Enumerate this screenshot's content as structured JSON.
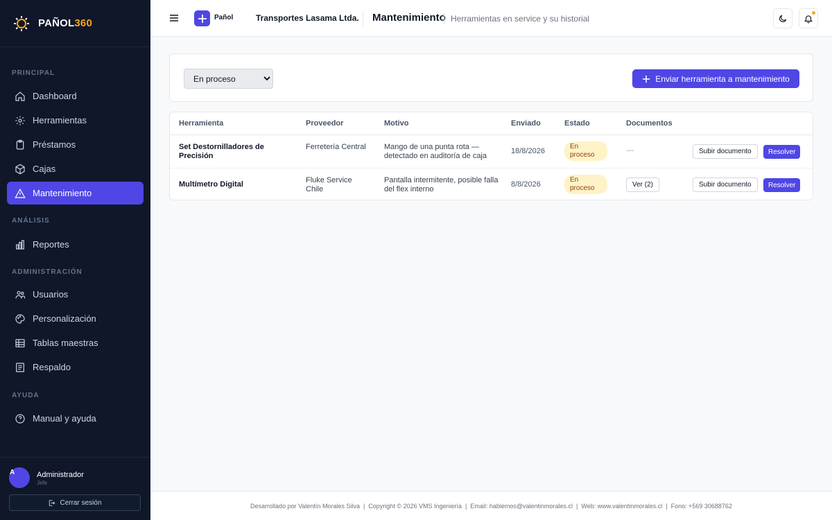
{
  "brand": {
    "name_main": "PAÑOL",
    "name_accent": "360",
    "accent_color": "#f5a623"
  },
  "sidebar": {
    "sections": [
      {
        "label": "PRINCIPAL"
      },
      {
        "label": "ANÁLISIS"
      },
      {
        "label": "ADMINISTRACIÓN"
      },
      {
        "label": "AYUDA"
      }
    ],
    "items": [
      {
        "label": "Dashboard",
        "icon": "home-icon"
      },
      {
        "label": "Herramientas",
        "icon": "gear-icon"
      },
      {
        "label": "Préstamos",
        "icon": "clipboard-icon"
      },
      {
        "label": "Cajas",
        "icon": "box-icon"
      },
      {
        "label": "Mantenimiento",
        "icon": "warning-icon",
        "active": true
      },
      {
        "label": "Reportes",
        "icon": "bar-chart-icon"
      },
      {
        "label": "Usuarios",
        "icon": "users-icon"
      },
      {
        "label": "Personalización",
        "icon": "palette-icon"
      },
      {
        "label": "Tablas maestras",
        "icon": "table-icon"
      },
      {
        "label": "Respaldo",
        "icon": "archive-icon"
      },
      {
        "label": "Manual y ayuda",
        "icon": "help-circle-icon"
      }
    ],
    "user": {
      "initial": "A",
      "name": "Administrador",
      "role": "Jefe"
    },
    "logout_label": "Cerrar sesión"
  },
  "header": {
    "app_label": "Pañol",
    "company": "Transportes Lasama Ltda.",
    "title": "Mantenimiento",
    "subtitle": "Herramientas en service y su historial"
  },
  "filter": {
    "selected": "En proceso",
    "new_button": "Enviar herramienta a mantenimiento"
  },
  "table": {
    "columns": [
      "Herramienta",
      "Proveedor",
      "Motivo",
      "Enviado",
      "Estado",
      "Documentos"
    ],
    "rows": [
      {
        "tool": "Set Destornilladores de Precisión",
        "provider": "Ferretería Central",
        "reason": "Mango de una punta rota — detectado en auditoría de caja",
        "sent": "18/8/2026",
        "status": "En proceso",
        "documents": "—",
        "upload_label": "Subir documento",
        "resolve_label": "Resolver"
      },
      {
        "tool": "Multímetro Digital",
        "provider": "Fluke Service Chile",
        "reason": "Pantalla intermitente, posible falla del flex interno",
        "sent": "8/8/2026",
        "status": "En proceso",
        "documents": "Ver (2)",
        "upload_label": "Subir documento",
        "resolve_label": "Resolver"
      }
    ]
  },
  "footer": {
    "text": "Desarrollado por Valentín Morales Silva  |  Copyright © 2026 VMS Ingeniería  |  Email: hablemos@valentinmorales.cl  |  Web: www.valentinmorales.cl  |  Fono: +569 30688762"
  },
  "colors": {
    "primary": "#4f46e5",
    "sidebar_bg": "#0f1729",
    "badge_bg": "#fef3c7",
    "badge_text": "#92400e"
  }
}
